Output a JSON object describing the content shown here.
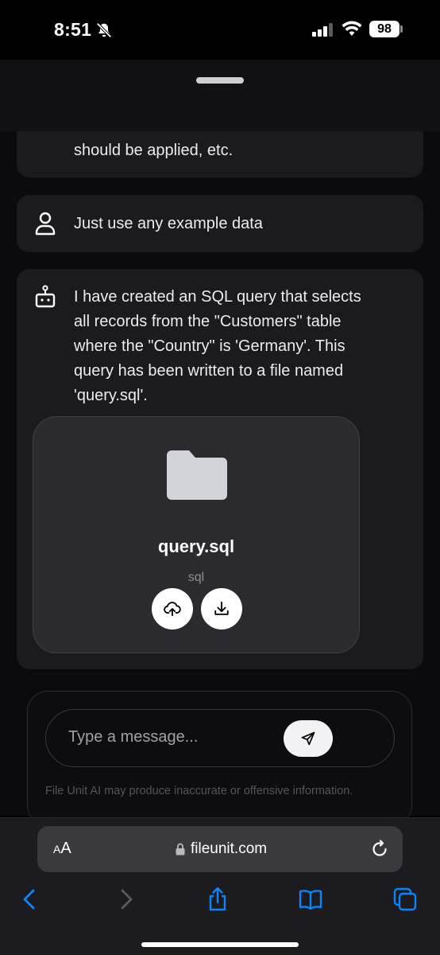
{
  "status_bar": {
    "time": "8:51",
    "battery": "98"
  },
  "chat": {
    "messages": [
      {
        "role": "assistant",
        "text": "should be applied, etc."
      },
      {
        "role": "user",
        "text": "Just use any example data"
      },
      {
        "role": "assistant",
        "lines": [
          "I have created an SQL query that selects",
          "all records from the \"Customers\" table",
          "where the \"Country\" is 'Germany'. This",
          "query has been written to a file named",
          "'query.sql'."
        ]
      }
    ],
    "file": {
      "name": "query.sql",
      "type": "sql"
    }
  },
  "composer": {
    "placeholder": "Type a message...",
    "disclaimer": "File Unit AI may produce inaccurate or offensive information."
  },
  "browser": {
    "aa_small": "A",
    "aa_large": "A",
    "url": "fileunit.com"
  },
  "colors": {
    "background": "#0b0b0d",
    "bubble": "#1b1b1e",
    "file_card": "#2b2b2f",
    "browser_accent": "#0a84ff"
  },
  "icons": [
    "bell-off-icon",
    "signal-icon",
    "wifi-icon",
    "user-icon",
    "bot-icon",
    "folder-icon",
    "upload-icon",
    "download-icon",
    "send-icon",
    "lock-icon",
    "reload-icon",
    "back-icon",
    "forward-icon",
    "share-icon",
    "bookmarks-icon",
    "tabs-icon"
  ]
}
